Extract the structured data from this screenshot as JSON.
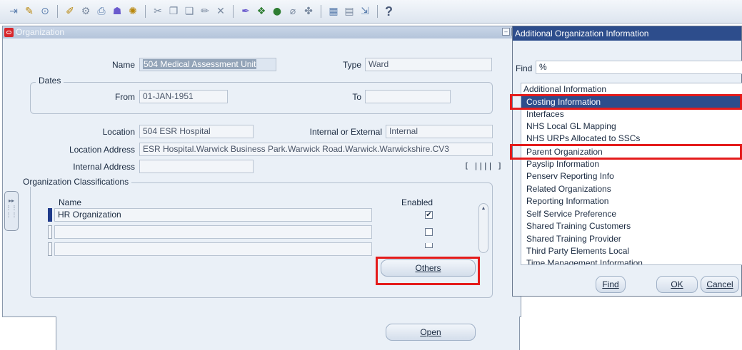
{
  "toolbar": {
    "icons": [
      "new-icon",
      "save-icon",
      "switch-icon",
      "open-icon",
      "find-icon",
      "print-icon",
      "flag-icon",
      "zoom-icon",
      "cut-icon",
      "copy-icon",
      "paste-icon",
      "clear-icon",
      "clear-record-icon",
      "delete-icon",
      "edit-icon",
      "attachments-icon",
      "globe-icon",
      "paperclip-icon",
      "help-folder-icon",
      "calendar-icon",
      "calendar2-icon",
      "exit-icon"
    ],
    "help_label": "?"
  },
  "main_window": {
    "title": "Organization",
    "name_label": "Name",
    "name_value": "504 Medical Assessment Unit",
    "type_label": "Type",
    "type_value": "Ward",
    "dates_label": "Dates",
    "from_label": "From",
    "from_value": "01-JAN-1951",
    "to_label": "To",
    "to_value": "",
    "location_label": "Location",
    "location_value": "504 ESR Hospital",
    "internal_external_label": "Internal or External",
    "internal_external_value": "Internal",
    "location_address_label": "Location Address",
    "location_address_value": "ESR Hospital.Warwick Business Park.Warwick Road.Warwick.Warwickshire.CV3",
    "internal_address_label": "Internal Address",
    "internal_address_value": "",
    "flex_field": "[ |||| ]",
    "classifications_label": "Organization Classifications",
    "col_name": "Name",
    "col_enabled": "Enabled",
    "rows": [
      {
        "name": "HR Organization",
        "enabled": "✔"
      },
      {
        "name": "",
        "enabled": ""
      },
      {
        "name": "",
        "enabled": ""
      }
    ],
    "others_button": "Others",
    "open_button": "Open"
  },
  "dialog": {
    "title": "Additional Organization Information",
    "find_label": "Find",
    "find_value": "%",
    "list_header": "Additional Information",
    "items": [
      "Costing Information",
      "Interfaces",
      "NHS Local GL Mapping",
      "NHS URPs Allocated to SSCs",
      "Parent Organization",
      "Payslip Information",
      "Penserv Reporting Info",
      "Related Organizations",
      "Reporting Information",
      "Self Service Preference",
      "Shared Training Customers",
      "Shared Training Provider",
      "Third Party Elements Local",
      "Time Management Information"
    ],
    "selected_index": 0,
    "find_button": "Find",
    "ok_button": "OK",
    "cancel_button": "Cancel"
  },
  "colors": {
    "selection": "#2d4d8c",
    "highlight_box": "#e41b1b",
    "window_bg": "#eaf0f7"
  }
}
